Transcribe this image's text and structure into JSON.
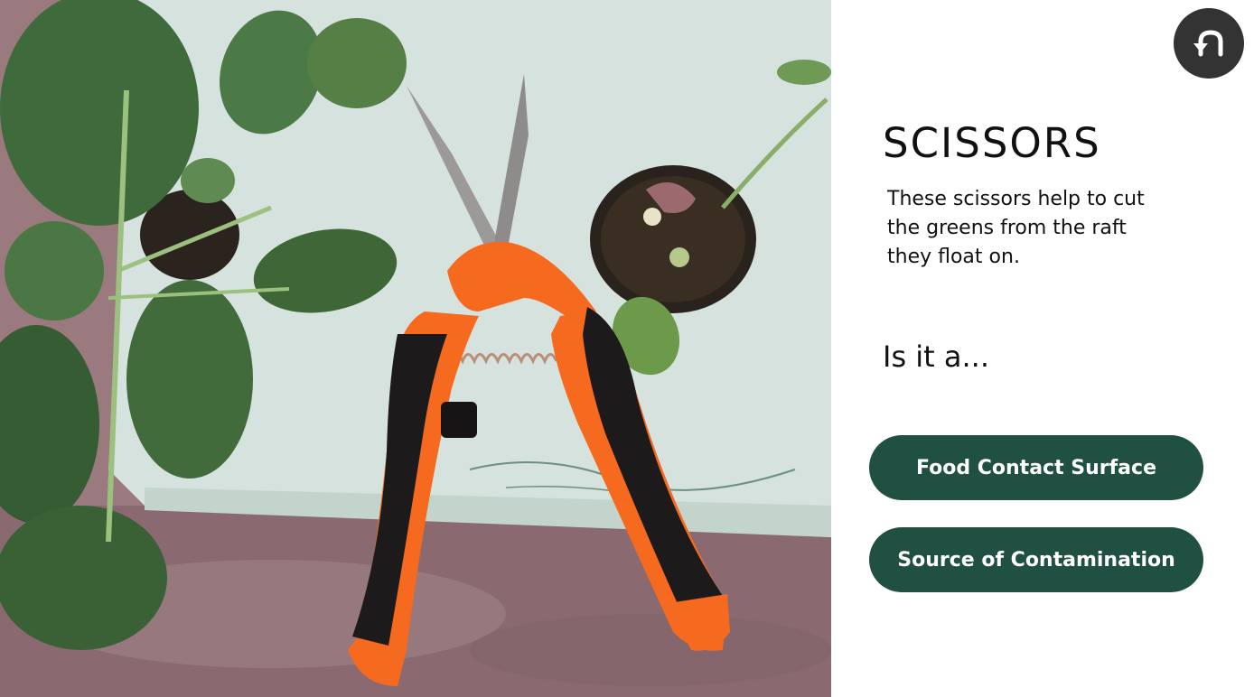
{
  "photo": {
    "icon": "scissors-photo",
    "subject": "orange and black pruning scissors on a raft with greens"
  },
  "back": {
    "icon": "undo-arrow-icon"
  },
  "card": {
    "title": "SCISSORS",
    "description": "These scissors help to cut the greens from the raft they float on.",
    "question": "Is it a...",
    "choices": [
      {
        "label": "Food Contact Surface"
      },
      {
        "label": "Source of Contamination"
      }
    ]
  },
  "colors": {
    "button_bg": "#1f5041",
    "back_button_bg": "#333333",
    "scissors_orange": "#f56a1f",
    "scissors_black": "#1c1a1a",
    "raft": "#cfe6dc",
    "floor": "#9a7a7e",
    "leaf": "#3f6a3c"
  }
}
